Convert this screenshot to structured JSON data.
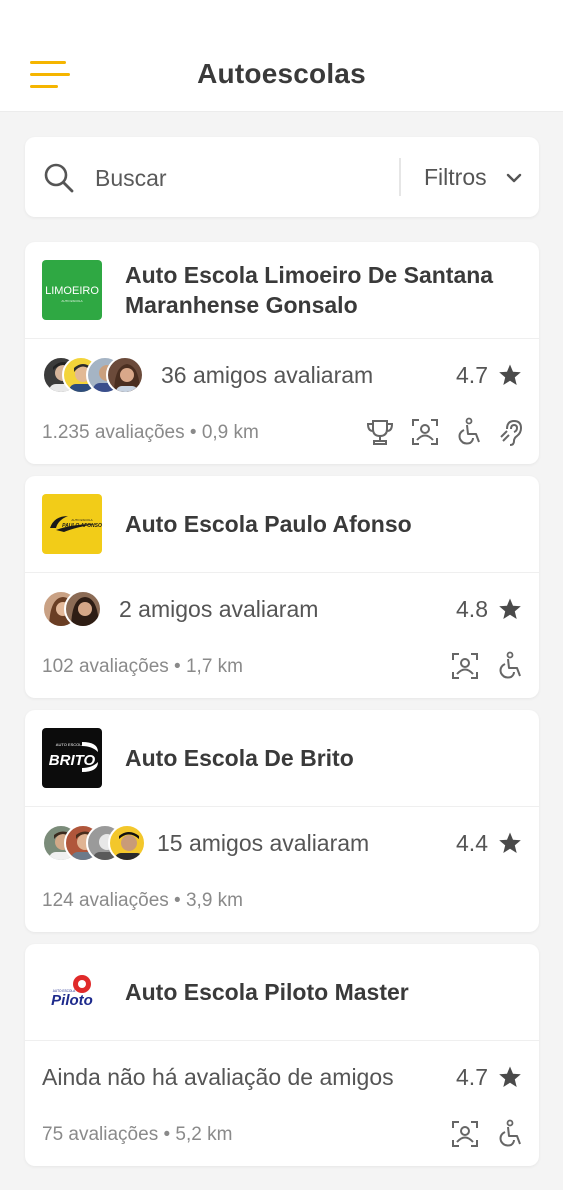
{
  "header": {
    "title": "Autoescolas",
    "menu_icon": "hamburger-menu-icon"
  },
  "colors": {
    "accent": "#f5b500",
    "text": "#3a3a3a",
    "muted": "#8a8a8a",
    "background": "#f4f4f4"
  },
  "search": {
    "placeholder": "Buscar",
    "value": "",
    "filters_label": "Filtros"
  },
  "schools": [
    {
      "name": "Auto Escola Limoeiro De Santana Maranhense Gonsalo",
      "logo_text": "LIMOEIRO",
      "logo_subtext": "AUTO ESCOLA",
      "friends_text": "36 amigos avaliaram",
      "rating": "4.7",
      "reviews": "1.235 avaliações",
      "distance": "0,9 km",
      "amenities": [
        "trophy-icon",
        "face-scan-icon",
        "wheelchair-icon",
        "hearing-icon"
      ]
    },
    {
      "name": "Auto Escola Paulo Afonso",
      "logo_text": "PAULO AFONSO",
      "logo_subtext": "AUTO ESCOLA",
      "friends_text": "2 amigos avaliaram",
      "rating": "4.8",
      "reviews": "102 avaliações",
      "distance": "1,7 km",
      "amenities": [
        "face-scan-icon",
        "wheelchair-icon"
      ]
    },
    {
      "name": "Auto Escola De Brito",
      "logo_text": "BRITO",
      "logo_subtext": "AUTO ESCOLA",
      "friends_text": "15 amigos avaliaram",
      "rating": "4.4",
      "reviews": "124 avaliações",
      "distance": "3,9 km",
      "amenities": []
    },
    {
      "name": "Auto Escola Piloto Master",
      "logo_text": "Piloto",
      "logo_subtext": "AUTO ESCOLA",
      "friends_text": "Ainda não há avaliação de amigos",
      "rating": "4.7",
      "reviews": "75 avaliações",
      "distance": "5,2 km",
      "amenities": [
        "face-scan-icon",
        "wheelchair-icon"
      ]
    }
  ],
  "separator": "•"
}
